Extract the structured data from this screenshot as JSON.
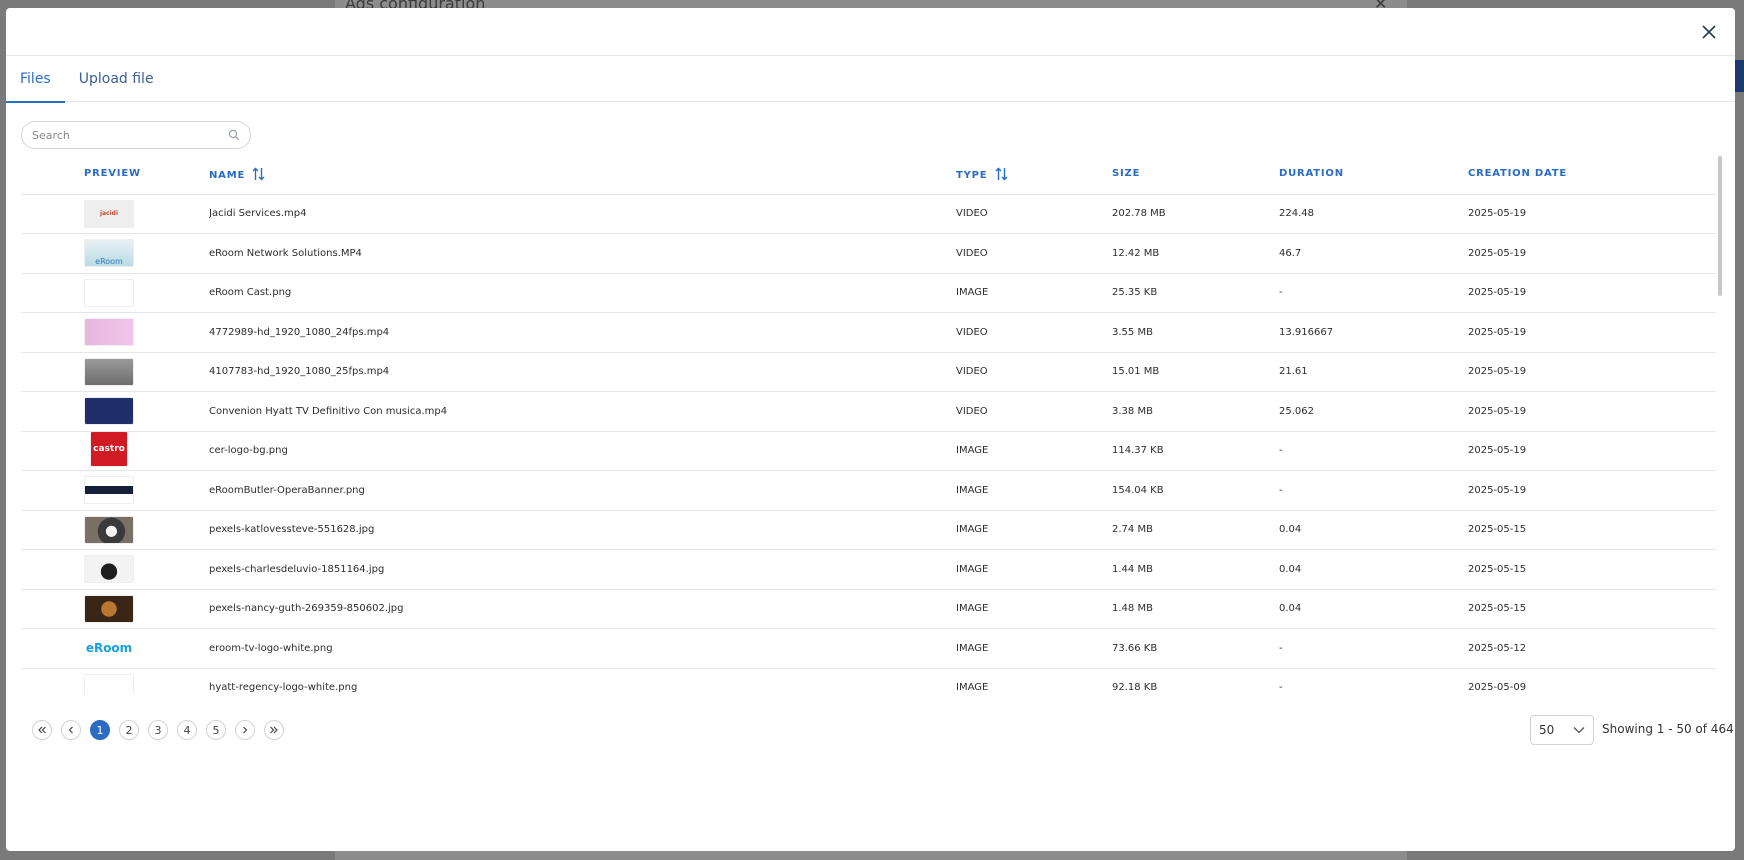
{
  "background": {
    "panel_title": "Ads configuration"
  },
  "tabs": [
    {
      "label": "Files",
      "active": true
    },
    {
      "label": "Upload file",
      "active": false
    }
  ],
  "search": {
    "placeholder": "Search"
  },
  "table": {
    "columns": [
      "PREVIEW",
      "NAME",
      "TYPE",
      "SIZE",
      "DURATION",
      "CREATION DATE"
    ],
    "rows": [
      {
        "thumb": "jacidi",
        "name": "Jacidi Services.mp4",
        "type": "VIDEO",
        "size": "202.78 MB",
        "duration": "224.48",
        "date": "2025-05-19"
      },
      {
        "thumb": "eroom-light",
        "name": "eRoom Network Solutions.MP4",
        "type": "VIDEO",
        "size": "12.42 MB",
        "duration": "46.7",
        "date": "2025-05-19"
      },
      {
        "thumb": "blank",
        "name": "eRoom Cast.png",
        "type": "IMAGE",
        "size": "25.35 KB",
        "duration": "-",
        "date": "2025-05-19"
      },
      {
        "thumb": "pink",
        "name": "4772989-hd_1920_1080_24fps.mp4",
        "type": "VIDEO",
        "size": "3.55 MB",
        "duration": "13.916667",
        "date": "2025-05-19"
      },
      {
        "thumb": "grey",
        "name": "4107783-hd_1920_1080_25fps.mp4",
        "type": "VIDEO",
        "size": "15.01 MB",
        "duration": "21.61",
        "date": "2025-05-19"
      },
      {
        "thumb": "navy",
        "name": "Convenion Hyatt TV Definitivo Con musica.mp4",
        "type": "VIDEO",
        "size": "3.38 MB",
        "duration": "25.062",
        "date": "2025-05-19"
      },
      {
        "thumb": "castro",
        "name": "cer-logo-bg.png",
        "type": "IMAGE",
        "size": "114.37 KB",
        "duration": "-",
        "date": "2025-05-19"
      },
      {
        "thumb": "banner",
        "name": "eRoomButler-OperaBanner.png",
        "type": "IMAGE",
        "size": "154.04 KB",
        "duration": "-",
        "date": "2025-05-19"
      },
      {
        "thumb": "dog1",
        "name": "pexels-katlovessteve-551628.jpg",
        "type": "IMAGE",
        "size": "2.74 MB",
        "duration": "0.04",
        "date": "2025-05-15"
      },
      {
        "thumb": "dog2",
        "name": "pexels-charlesdeluvio-1851164.jpg",
        "type": "IMAGE",
        "size": "1.44 MB",
        "duration": "0.04",
        "date": "2025-05-15"
      },
      {
        "thumb": "dog3",
        "name": "pexels-nancy-guth-269359-850602.jpg",
        "type": "IMAGE",
        "size": "1.48 MB",
        "duration": "0.04",
        "date": "2025-05-15"
      },
      {
        "thumb": "eroom-logo",
        "name": "eroom-tv-logo-white.png",
        "type": "IMAGE",
        "size": "73.66 KB",
        "duration": "-",
        "date": "2025-05-12"
      },
      {
        "thumb": "blank",
        "name": "hyatt-regency-logo-white.png",
        "type": "IMAGE",
        "size": "92.18 KB",
        "duration": "-",
        "date": "2025-05-09"
      }
    ]
  },
  "thumb_text": {
    "jacidi": "jacidi",
    "eroom": "eRoom",
    "castro": "castro"
  },
  "pagination": {
    "first": "«",
    "prev": "‹",
    "pages": [
      "1",
      "2",
      "3",
      "4",
      "5"
    ],
    "current": "1",
    "next": "›",
    "last": "»"
  },
  "page_size": {
    "value": "50"
  },
  "showing": "Showing 1 - 50 of 464",
  "colors": {
    "accent": "#2a6cc4"
  }
}
